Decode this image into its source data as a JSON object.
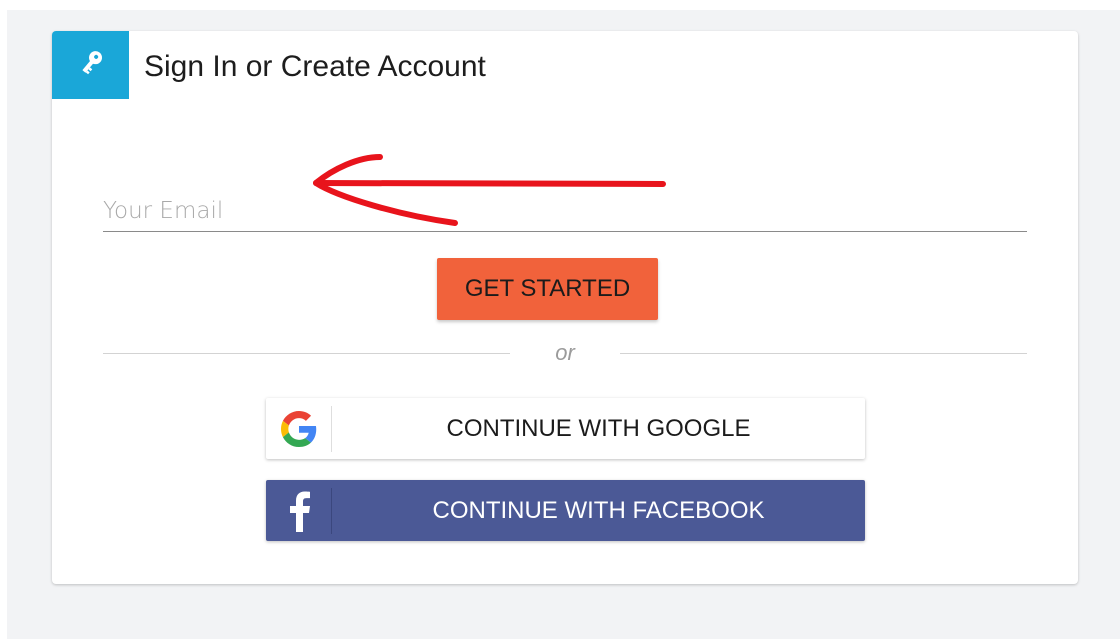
{
  "card": {
    "title": "Sign In or Create Account",
    "key_icon": "key-icon"
  },
  "email": {
    "placeholder": "Your Email",
    "value": ""
  },
  "annotation": {
    "icon": "red-arrow-icon",
    "color": "#e8141c"
  },
  "get_started": {
    "label": "GET STARTED",
    "color": "#f1623b"
  },
  "divider": {
    "text": "or"
  },
  "google": {
    "label": "CONTINUE WITH GOOGLE",
    "icon": "google-icon"
  },
  "facebook": {
    "label": "CONTINUE WITH FACEBOOK",
    "icon": "facebook-icon",
    "color": "#4b5996"
  },
  "colors": {
    "accent": "#1aa7d8",
    "background": "#f2f3f5"
  }
}
